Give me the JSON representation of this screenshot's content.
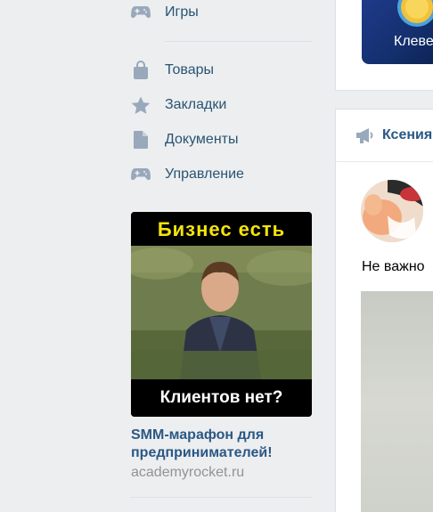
{
  "sidebar": {
    "items": [
      {
        "label": "Игры",
        "icon": "gamepad-icon"
      },
      {
        "label": "Товары",
        "icon": "shopping-bag-icon"
      },
      {
        "label": "Закладки",
        "icon": "star-icon"
      },
      {
        "label": "Документы",
        "icon": "document-icon"
      },
      {
        "label": "Управление",
        "icon": "gamepad-icon"
      }
    ]
  },
  "ad": {
    "image_top_text": "Бизнес есть",
    "image_bottom_text": "Клиентов нет?",
    "title": "SMM-марафон для предпринимателей!",
    "domain": "academyrocket.ru"
  },
  "right": {
    "banner_text": "Клеве",
    "post_author": "Ксения",
    "post_text": "Не важно"
  },
  "colors": {
    "background": "#edeef0",
    "link": "#2a5885",
    "icon": "#99a9bc",
    "ad_yellow": "#f5e40a"
  }
}
